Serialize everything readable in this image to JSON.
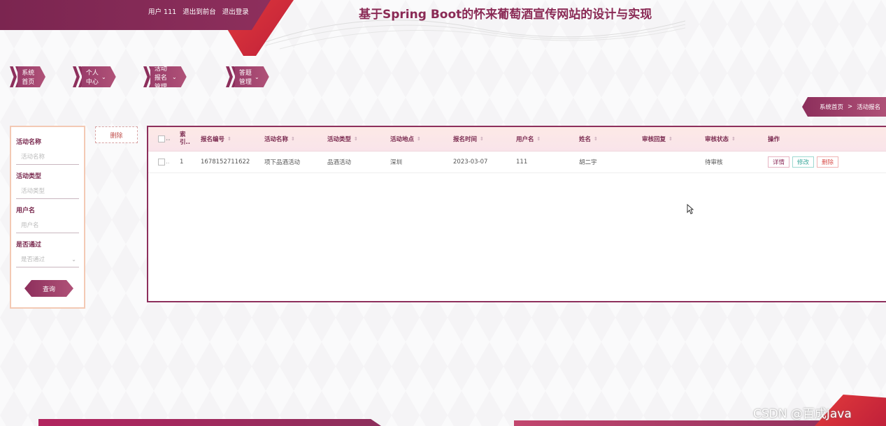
{
  "header": {
    "user_links": [
      "用户 111",
      "退出到前台",
      "退出登录"
    ],
    "site_title": "基于Spring Boot的怀来葡萄酒宣传网站的设计与实现"
  },
  "nav": {
    "items": [
      {
        "label": "系统首页",
        "arrow": ""
      },
      {
        "label": "个人中心",
        "arrow": "⌄"
      },
      {
        "label": "活动报名管理",
        "arrow": "⌄"
      },
      {
        "label": "答题管理",
        "arrow": "⌄"
      }
    ]
  },
  "breadcrumb": {
    "home": "系统首页",
    "sep": ">",
    "current": "活动报名"
  },
  "search": {
    "fields": [
      {
        "label": "活动名称",
        "placeholder": "活动名称"
      },
      {
        "label": "活动类型",
        "placeholder": "活动类型"
      },
      {
        "label": "用户名",
        "placeholder": "用户名"
      },
      {
        "label": "是否通过",
        "placeholder": "是否通过",
        "dropdown": "⌄"
      }
    ],
    "button": "查询"
  },
  "toolbar": {
    "delete_label": "删除"
  },
  "table": {
    "index_header": [
      "索",
      "引.."
    ],
    "columns": [
      "报名编号",
      "活动名称",
      "活动类型",
      "活动地点",
      "报名时间",
      "用户名",
      "姓名",
      "审核回复",
      "审核状态",
      "操作"
    ],
    "sort_icon": "⇕",
    "rows": [
      {
        "index": "1",
        "cells": [
          "1678152711622",
          "项下品酒活动",
          "品酒活动",
          "深圳",
          "2023-03-07",
          "111",
          "胡二宇",
          "",
          "待审核"
        ],
        "actions": [
          "详情",
          "修改",
          "删除"
        ]
      }
    ]
  },
  "watermark": "CSDN @百成Java",
  "colors": {
    "primary": "#8d2f5c",
    "accent_red": "#e23b3b",
    "header_bg": "#fde9e6"
  }
}
